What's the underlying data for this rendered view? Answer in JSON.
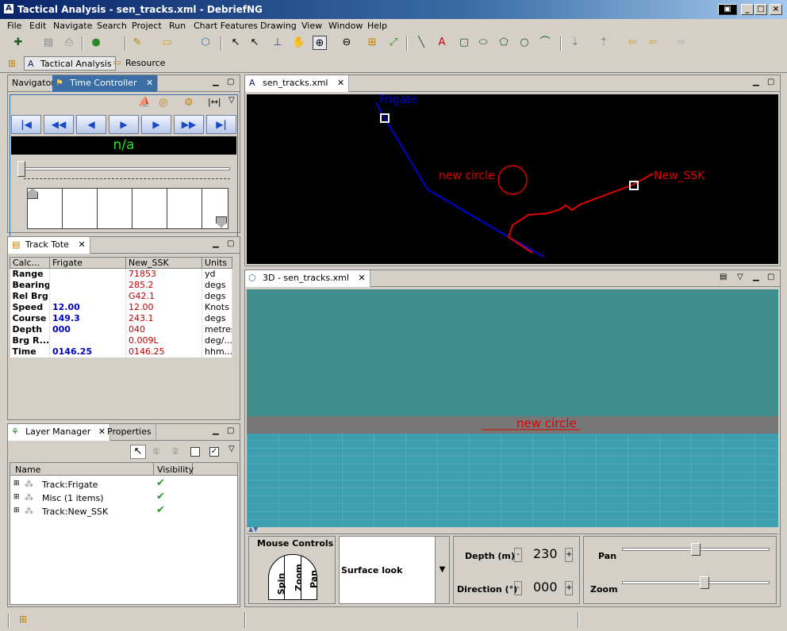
{
  "window": {
    "title": "Tactical Analysis - sen_tracks.xml - DebriefNG"
  },
  "menu": [
    "File",
    "Edit",
    "Navigate",
    "Search",
    "Project",
    "Run",
    "Chart Features",
    "Drawing",
    "View",
    "Window",
    "Help"
  ],
  "perspective": {
    "tactical": "Tactical Analysis",
    "resource": "Resource"
  },
  "left_top": {
    "tab_navigator": "Navigator",
    "tab_time": "Time Controller",
    "time_display": "n/a"
  },
  "tote": {
    "tab": "Track Tote",
    "headers": [
      "Calc...",
      "Frigate",
      "New_SSK",
      "Units"
    ],
    "rows": [
      [
        "Range",
        "",
        "71853",
        "yd"
      ],
      [
        "Bearing",
        "",
        "285.2",
        "degs"
      ],
      [
        "Rel Brg",
        "",
        "G42.1",
        "degs"
      ],
      [
        "Speed",
        "12.00",
        "12.00",
        "Knots"
      ],
      [
        "Course",
        "149.3",
        "243.1",
        "degs"
      ],
      [
        "Depth",
        "000",
        "040",
        "metres"
      ],
      [
        "Brg R...",
        "",
        "0.009L",
        "deg/..."
      ],
      [
        "Time",
        "0146.25",
        "0146.25",
        "hhm..."
      ]
    ]
  },
  "layers": {
    "tab_layer": "Layer Manager",
    "tab_props": "Properties",
    "col_name": "Name",
    "col_vis": "Visibility",
    "items": [
      "Track:Frigate",
      "Misc (1 items)",
      "Track:New_SSK"
    ]
  },
  "plot": {
    "tab": "sen_tracks.xml",
    "labels": {
      "frigate": "Frigate",
      "circle": "new circle",
      "ssk": "New_SSK"
    },
    "colors": {
      "frigate": "#0000d0",
      "ssk": "#e00000"
    }
  },
  "view3d": {
    "tab": "3D - sen_tracks.xml",
    "circle_label": "new circle",
    "mouse_title": "Mouse Controls",
    "modes": [
      "Spin",
      "Zoom",
      "Pan"
    ],
    "look": "Surface look",
    "depth_label": "Depth (m)",
    "depth_value": "230",
    "dir_label": "Direction (°)",
    "dir_value": "000",
    "pan_label": "Pan",
    "zoom_label": "Zoom",
    "pan_level": 0.5,
    "zoom_level": 0.56
  }
}
